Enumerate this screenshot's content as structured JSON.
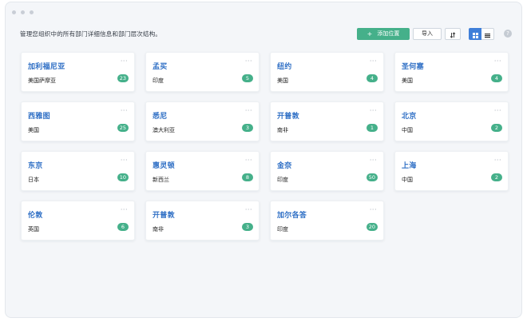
{
  "header": {
    "description": "管理您组织中的所有部门详细信息和部门层次结构。",
    "add_label": "添加位置",
    "add_icon": "plus-icon",
    "import_label": "导入",
    "sort_icon": "sort-icon",
    "grid_view_icon": "grid-view-icon",
    "list_view_icon": "list-view-icon",
    "help_icon": "question-icon",
    "help_glyph": "?"
  },
  "colors": {
    "accent_green": "#45b08a",
    "accent_blue": "#3f7fd9",
    "link_blue": "#2f6fc5"
  },
  "locations": [
    {
      "name": "加利福尼亚",
      "region": "美国萨摩亚",
      "count": "23"
    },
    {
      "name": "孟买",
      "region": "印度",
      "count": "5"
    },
    {
      "name": "纽约",
      "region": "美国",
      "count": "4"
    },
    {
      "name": "圣何塞",
      "region": "美国",
      "count": "4"
    },
    {
      "name": "西雅图",
      "region": "美国",
      "count": "25"
    },
    {
      "name": "悉尼",
      "region": "澳大利亚",
      "count": "3"
    },
    {
      "name": "开普敦",
      "region": "南非",
      "count": "1"
    },
    {
      "name": "北京",
      "region": "中国",
      "count": "2"
    },
    {
      "name": "东京",
      "region": "日本",
      "count": "10"
    },
    {
      "name": "惠灵顿",
      "region": "新西兰",
      "count": "8"
    },
    {
      "name": "金奈",
      "region": "印度",
      "count": "50"
    },
    {
      "name": "上海",
      "region": "中国",
      "count": "2"
    },
    {
      "name": "伦敦",
      "region": "英国",
      "count": "6"
    },
    {
      "name": "开普敦",
      "region": "南非",
      "count": "3"
    },
    {
      "name": "加尔各答",
      "region": "印度",
      "count": "20"
    }
  ]
}
